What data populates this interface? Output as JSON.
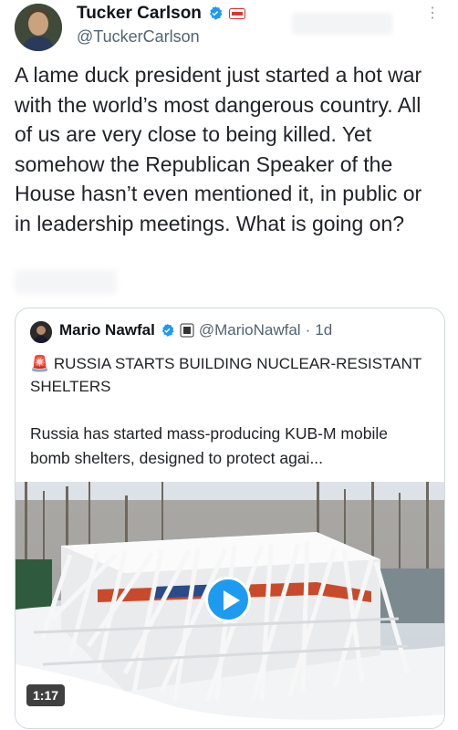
{
  "author": {
    "name": "Tucker Carlson",
    "handle": "@TuckerCarlson"
  },
  "tweet": {
    "text": "A lame duck president just started a hot war with the world’s most dangerous country. All of us are very close to being killed. Yet somehow the Republican Speaker of the House hasn’t even mentioned it, in public or in leadership meetings. What is going on?"
  },
  "quoted": {
    "name": "Mario Nawfal",
    "handle": "@MarioNawfal",
    "separator": "·",
    "time": "1d",
    "title": "🚨 RUSSIA STARTS BUILDING NUCLEAR-RESISTANT SHELTERS",
    "body": "Russia has started mass-producing KUB-M mobile bomb shelters, designed to protect agai...",
    "video": {
      "duration": "1:17"
    }
  },
  "colors": {
    "verified": "#1d9bf0",
    "play": "#1d9bf0",
    "shelter_stripe": "#c94a2a"
  }
}
